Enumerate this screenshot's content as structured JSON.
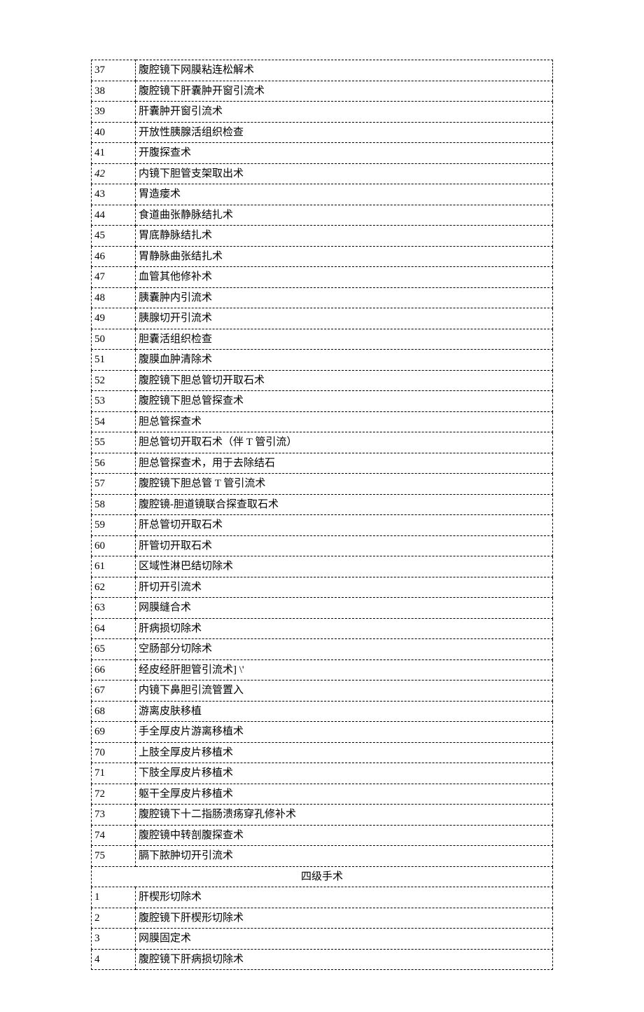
{
  "rows": [
    {
      "num": "37",
      "txt": "腹腔镜下网膜粘连松解术"
    },
    {
      "num": "38",
      "txt": "腹腔镜下肝囊肿开窗引流术"
    },
    {
      "num": "39",
      "txt": "肝囊肿开窗引流术"
    },
    {
      "num": "40",
      "txt": "开放性胰腺活组织检查"
    },
    {
      "num": "41",
      "txt": "开腹探查术"
    },
    {
      "num": "42",
      "txt": "内镜下胆管支架取出术",
      "italic": true
    },
    {
      "num": "43",
      "txt": "胃造瘘术"
    },
    {
      "num": "44",
      "txt": "食道曲张静脉结扎术"
    },
    {
      "num": "45",
      "txt": "胃底静脉结扎术"
    },
    {
      "num": "46",
      "txt": "胃静脉曲张结扎术"
    },
    {
      "num": "47",
      "txt": "血管其他修补术"
    },
    {
      "num": "48",
      "txt": "胰囊肿内引流术"
    },
    {
      "num": "49",
      "txt": "胰腺切开引流术"
    },
    {
      "num": "50",
      "txt": "胆囊活组织检查"
    },
    {
      "num": "51",
      "txt": "腹膜血肿清除术"
    },
    {
      "num": "52",
      "txt": "腹腔镜下胆总管切开取石术"
    },
    {
      "num": "53",
      "txt": "腹腔镜下胆总管探查术"
    },
    {
      "num": "54",
      "txt": "胆总管探查术"
    },
    {
      "num": "55",
      "txt": "胆总管切开取石术（伴 T 管引流）"
    },
    {
      "num": "56",
      "txt": "胆总管探查术，用于去除结石"
    },
    {
      "num": "57",
      "txt": "腹腔镜下胆总管 T 管引流术"
    },
    {
      "num": "58",
      "txt": "腹腔镜-胆道镜联合探查取石术"
    },
    {
      "num": "59",
      "txt": "肝总管切开取石术"
    },
    {
      "num": "60",
      "txt": "肝管切开取石术"
    },
    {
      "num": "61",
      "txt": "区域性淋巴结切除术"
    },
    {
      "num": "62",
      "txt": "肝切开引流术"
    },
    {
      "num": "63",
      "txt": "网膜缝合术"
    },
    {
      "num": "64",
      "txt": "肝病损切除术"
    },
    {
      "num": "65",
      "txt": "空肠部分切除术"
    },
    {
      "num": "66",
      "txt": "经皮经肝胆管引流术] \\'"
    },
    {
      "num": "67",
      "txt": "内镜下鼻胆引流管置入"
    },
    {
      "num": "68",
      "txt": "游离皮肤移植"
    },
    {
      "num": "69",
      "txt": "手全厚皮片游离移植术"
    },
    {
      "num": "70",
      "txt": "上肢全厚皮片移植术"
    },
    {
      "num": "71",
      "txt": "下肢全厚皮片移植术"
    },
    {
      "num": "72",
      "txt": "躯干全厚皮片移植术"
    },
    {
      "num": "73",
      "txt": "腹腔镜下十二指肠溃疡穿孔修补术"
    },
    {
      "num": "74",
      "txt": "腹腔镜中转剖腹探查术"
    },
    {
      "num": "75",
      "txt": "膈下脓肿切开引流术"
    }
  ],
  "section_header": "四级手术",
  "rows2": [
    {
      "num": "1",
      "txt": "肝楔形切除术"
    },
    {
      "num": "2",
      "txt": "腹腔镜下肝楔形切除术"
    },
    {
      "num": "3",
      "txt": "网膜固定术"
    },
    {
      "num": "4",
      "txt": "腹腔镜下肝病损切除术"
    }
  ]
}
